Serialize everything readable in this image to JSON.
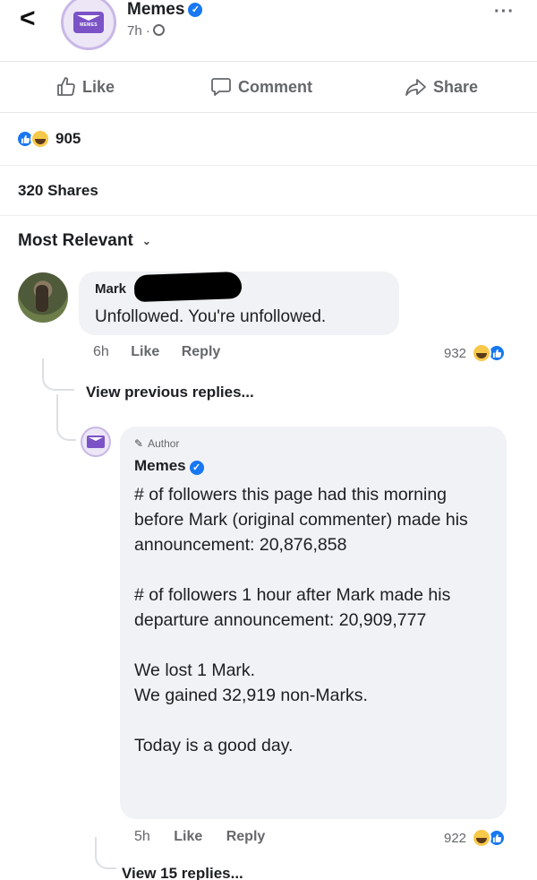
{
  "header": {
    "back_glyph": "<",
    "page_name": "Memes",
    "avatar_logo_text": "MEMES",
    "time": "7h ·",
    "more_glyph": "···"
  },
  "actions": {
    "like": "Like",
    "comment": "Comment",
    "share": "Share"
  },
  "reactions": {
    "count": "905",
    "types": [
      "like-icon",
      "haha-icon"
    ]
  },
  "shares": "320 Shares",
  "sort": {
    "label": "Most Relevant",
    "chevron": "⌄"
  },
  "comment": {
    "author": "Mark",
    "text": "Unfollowed.  You're unfollowed.",
    "time": "6h",
    "like": "Like",
    "reply": "Reply",
    "reaction_count": "932"
  },
  "view_previous": "View previous replies...",
  "reply": {
    "badge": "Author",
    "author": "Memes",
    "paragraphs": [
      "# of followers this page had this morning before Mark (original commenter) made his announcement: 20,876,858",
      "# of followers 1 hour after Mark made his departure announcement: 20,909,777",
      "We lost 1 Mark.\nWe gained 32,919 non-Marks.",
      "Today is a good day."
    ],
    "time": "5h",
    "like": "Like",
    "reply": "Reply",
    "reaction_count": "922"
  },
  "view_replies": "View 15 replies...",
  "colors": {
    "accent": "#1877f2",
    "brand": "#7b53c6",
    "bubble": "#f0f2f5",
    "muted": "#65676b"
  }
}
